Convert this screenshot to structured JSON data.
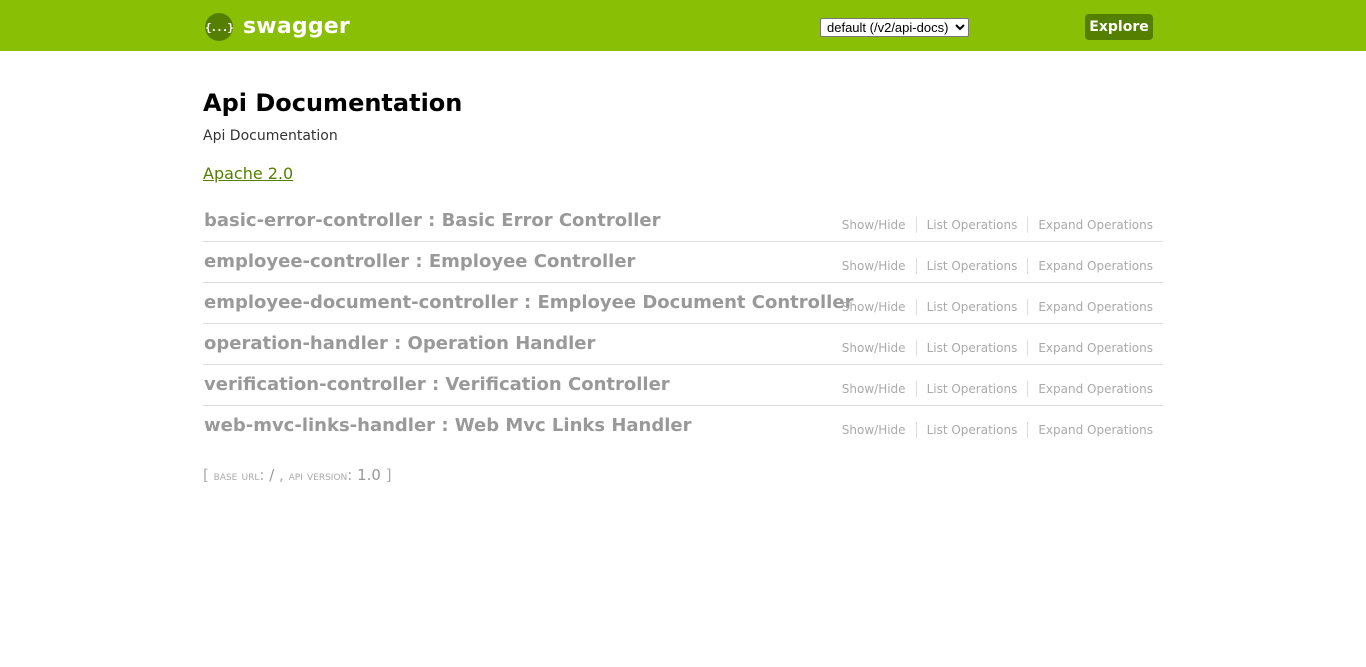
{
  "header": {
    "logo_icon": "{...}",
    "logo_icon_name": "swagger-braces-icon",
    "logo_text": "swagger",
    "api_selector_value": "default (/v2/api-docs)",
    "explore_label": "Explore",
    "colors": {
      "header_bg": "#89bf04",
      "accent_dark": "#547f00"
    }
  },
  "info": {
    "title": "Api Documentation",
    "description": "Api Documentation",
    "license_label": "Apache 2.0"
  },
  "resources": [
    {
      "title": "basic-error-controller : Basic Error Controller",
      "ops": [
        "Show/Hide",
        "List Operations",
        "Expand Operations"
      ]
    },
    {
      "title": "employee-controller : Employee Controller",
      "ops": [
        "Show/Hide",
        "List Operations",
        "Expand Operations"
      ]
    },
    {
      "title": "employee-document-controller : Employee Document Controller",
      "ops": [
        "Show/Hide",
        "List Operations",
        "Expand Operations"
      ]
    },
    {
      "title": "operation-handler : Operation Handler",
      "ops": [
        "Show/Hide",
        "List Operations",
        "Expand Operations"
      ]
    },
    {
      "title": "verification-controller : Verification Controller",
      "ops": [
        "Show/Hide",
        "List Operations",
        "Expand Operations"
      ]
    },
    {
      "title": "web-mvc-links-handler : Web Mvc Links Handler",
      "ops": [
        "Show/Hide",
        "List Operations",
        "Expand Operations"
      ]
    }
  ],
  "footer": {
    "open_bracket": "[",
    "base_url_label": "base url",
    "base_url_value": "/",
    "separator": ",",
    "api_version_label": "api version",
    "api_version_value": "1.0",
    "close_bracket": "]"
  }
}
